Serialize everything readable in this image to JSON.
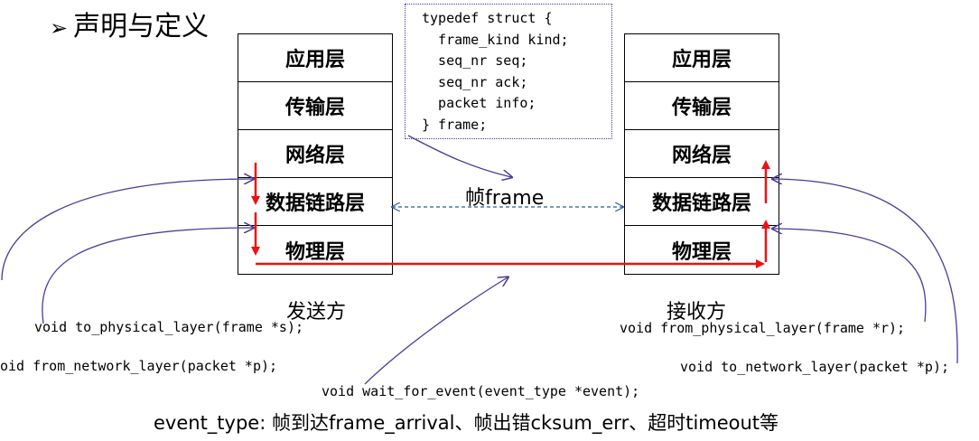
{
  "title": {
    "bullet": "➢",
    "text": "声明与定义"
  },
  "sender": {
    "layers": [
      "应用层",
      "传输层",
      "网络层",
      "数据链路层",
      "物理层"
    ],
    "label": "发送方"
  },
  "receiver": {
    "layers": [
      "应用层",
      "传输层",
      "网络层",
      "数据链路层",
      "物理层"
    ],
    "label": "接收方"
  },
  "struct_code": {
    "lines": [
      "typedef struct {",
      "  frame_kind kind;",
      "  seq_nr seq;",
      "  seq_nr ack;",
      "  packet info;",
      "} frame;"
    ]
  },
  "frame_label": "帧frame",
  "functions": {
    "to_physical": "void to_physical_layer(frame *s);",
    "from_network": "oid from_network_layer(packet *p);",
    "wait_for_event": "void wait_for_event(event_type *event);",
    "from_physical": "void from_physical_layer(frame *r);",
    "to_network": "void to_network_layer(packet *p);"
  },
  "event_type_note": "event_type: 帧到达frame_arrival、帧出错cksum_err、超时timeout等",
  "colors": {
    "flow": "#ee1111",
    "connector": "#4a3a9a",
    "dashed": "#2a5aa0"
  }
}
